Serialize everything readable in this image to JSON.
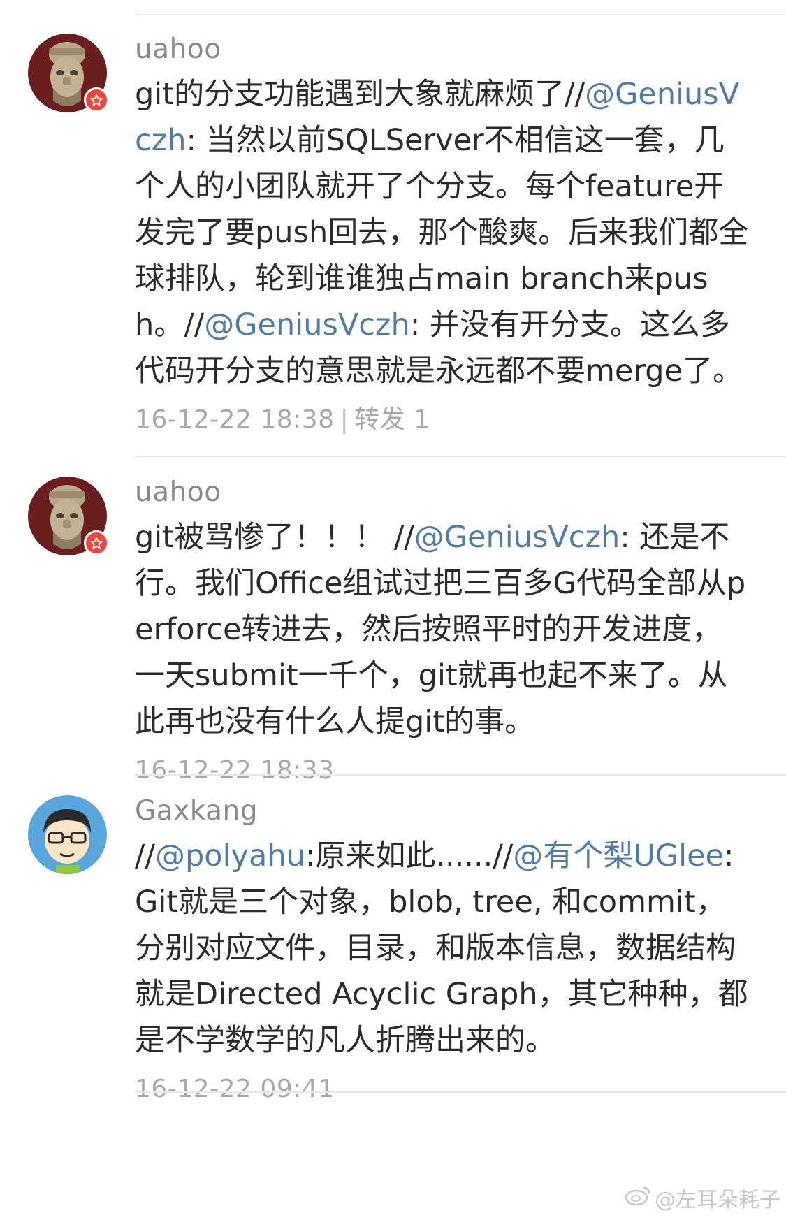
{
  "posts": [
    {
      "username": "uahoo",
      "text_segments": [
        {
          "t": "git的分支功能遇到大象就麻烦了//"
        },
        {
          "t": "@GeniusVczh",
          "mention": true
        },
        {
          "t": ": 当然以前SQLServer不相信这一套，几个人的小团队就开了个分支。每个feature开发完了要push回去，那个酸爽。后来我们都全球排队，轮到谁谁独占main branch来push。//"
        },
        {
          "t": "@GeniusVczh",
          "mention": true
        },
        {
          "t": ": 并没有开分支。这么多代码开分支的意思就是永远都不要merge了。"
        }
      ],
      "timestamp": "16-12-22 18:38",
      "repost_label": "转发 1"
    },
    {
      "username": "uahoo",
      "text_segments": [
        {
          "t": "git被骂惨了！！！ //"
        },
        {
          "t": "@GeniusVczh",
          "mention": true
        },
        {
          "t": ": 还是不行。我们Office组试过把三百多G代码全部从perforce转进去，然后按照平时的开发进度，一天submit一千个，git就再也起不来了。从此再也没有什么人提git的事。"
        }
      ],
      "timestamp": "16-12-22 18:33",
      "repost_label": ""
    },
    {
      "username": "Gaxkang",
      "text_segments": [
        {
          "t": "//"
        },
        {
          "t": "@polyahu",
          "mention": true
        },
        {
          "t": ":原来如此......//"
        },
        {
          "t": "@有个梨UGlee",
          "mention": true
        },
        {
          "t": ": Git就是三个对象，blob, tree, 和commit，分别对应文件，目录，和版本信息，数据结构就是Directed Acyclic Graph，其它种种，都是不学数学的凡人折腾出来的。"
        }
      ],
      "timestamp": "16-12-22 09:41",
      "repost_label": ""
    }
  ],
  "watermark": "@左耳朵耗子",
  "colors": {
    "mention": "#4f7cab",
    "username": "#8a8a8a",
    "meta": "#a9a9a9",
    "vip_badge": "#f0443c"
  },
  "icons": [
    "avatar-statue",
    "avatar-cartoon",
    "vip-star-badge",
    "weibo-logo"
  ]
}
